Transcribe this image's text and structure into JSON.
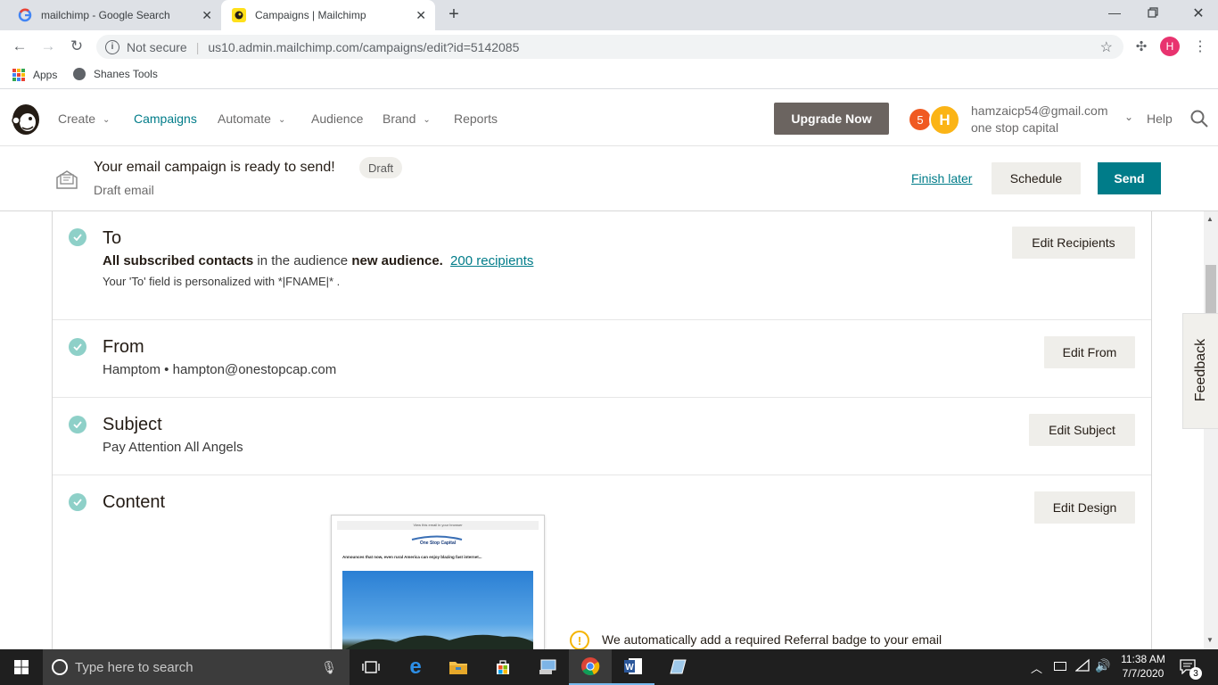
{
  "browser": {
    "tabs": [
      {
        "title": "mailchimp - Google Search",
        "active": false
      },
      {
        "title": "Campaigns | Mailchimp",
        "active": true
      }
    ],
    "security": "Not secure",
    "url": "us10.admin.mailchimp.com/campaigns/edit?id=5142085",
    "profile_initial": "H",
    "bookmarks": [
      "Apps",
      "Shanes Tools"
    ]
  },
  "mc_nav": {
    "items": [
      {
        "label": "Create",
        "dropdown": true
      },
      {
        "label": "Campaigns",
        "dropdown": false
      },
      {
        "label": "Automate",
        "dropdown": true
      },
      {
        "label": "Audience",
        "dropdown": false
      },
      {
        "label": "Brand",
        "dropdown": true
      },
      {
        "label": "Reports",
        "dropdown": false
      }
    ],
    "upgrade_label": "Upgrade Now",
    "notification_count": "5",
    "avatar_initial": "H",
    "account_email": "hamzaicp54@gmail.com",
    "account_name": "one stop capital",
    "help_label": "Help"
  },
  "draft_bar": {
    "title": "Your email campaign is ready to send!",
    "badge": "Draft",
    "subtitle": "Draft email",
    "finish_later": "Finish later",
    "schedule": "Schedule",
    "send": "Send"
  },
  "sections": {
    "to": {
      "title": "To",
      "line_bold1": "All subscribed contacts",
      "line_mid": " in the audience ",
      "line_bold2": "new audience.",
      "recipients_link": "200 recipients",
      "note": "Your 'To' field is personalized with *|FNAME|* .",
      "button": "Edit Recipients"
    },
    "from": {
      "title": "From",
      "value": "Hamptom • hampton@onestopcap.com",
      "button": "Edit From"
    },
    "subject": {
      "title": "Subject",
      "value": "Pay Attention All Angels",
      "button": "Edit Subject"
    },
    "content": {
      "title": "Content",
      "button": "Edit Design",
      "preview_top_link": "View this email in your browser",
      "preview_logo": "One Stop Capital",
      "preview_headline": "Announces that now, even rural America can enjoy blazing fast internet...",
      "referral_notice": "We automatically add a required Referral badge to your email"
    }
  },
  "feedback_label": "Feedback",
  "taskbar": {
    "search_placeholder": "Type here to search",
    "time": "11:38 AM",
    "date": "7/7/2020",
    "notification_count": "3"
  },
  "colors": {
    "accent_teal": "#007c89",
    "check_green": "#8ed0c8",
    "upgrade_bg": "#6b6460",
    "notif_orange": "#f05a22",
    "avatar_yellow": "#fbb416"
  }
}
